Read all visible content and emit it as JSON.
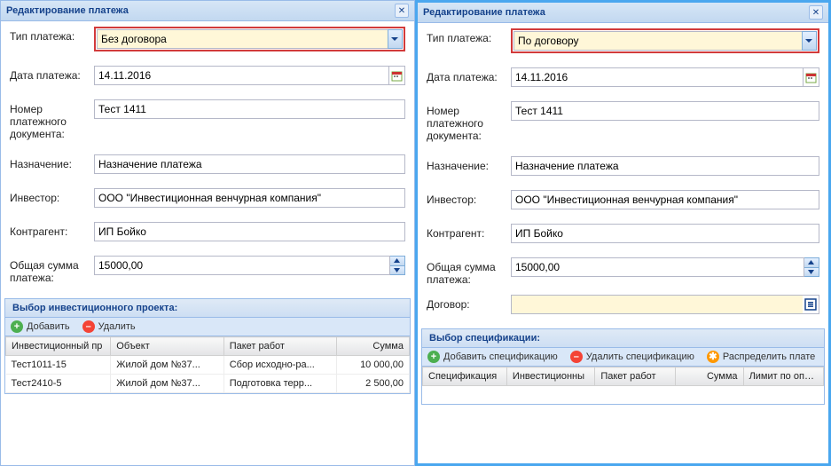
{
  "left": {
    "title": "Редактирование платежа",
    "fields": {
      "type_label": "Тип платежа:",
      "type_value": "Без договора",
      "date_label": "Дата платежа:",
      "date_value": "14.11.2016",
      "docnum_label": "Номер платежного документа:",
      "docnum_value": "Тест 1411",
      "purpose_label": "Назначение:",
      "purpose_value": "Назначение платежа",
      "investor_label": "Инвестор:",
      "investor_value": "ООО \"Инвестиционная венчурная компания\"",
      "contractor_label": "Контрагент:",
      "contractor_value": "ИП Бойко",
      "total_label": "Общая сумма платежа:",
      "total_value": "15000,00"
    },
    "panel_title": "Выбор инвестиционного проекта:",
    "toolbar": {
      "add": "Добавить",
      "del": "Удалить"
    },
    "grid": {
      "cols": [
        "Инвестиционный пр",
        "Объект",
        "Пакет работ",
        "Сумма"
      ],
      "rows": [
        {
          "proj": "Тест1011-15",
          "obj": "Жилой дом №37...",
          "pkg": "Сбор исходно-ра...",
          "sum": "10 000,00"
        },
        {
          "proj": "Тест2410-5",
          "obj": "Жилой дом №37...",
          "pkg": "Подготовка терр...",
          "sum": "2 500,00"
        }
      ]
    }
  },
  "right": {
    "title": "Редактирование платежа",
    "fields": {
      "type_label": "Тип платежа:",
      "type_value": "По договору",
      "date_label": "Дата платежа:",
      "date_value": "14.11.2016",
      "docnum_label": "Номер платежного документа:",
      "docnum_value": "Тест 1411",
      "purpose_label": "Назначение:",
      "purpose_value": "Назначение платежа",
      "investor_label": "Инвестор:",
      "investor_value": "ООО \"Инвестиционная венчурная компания\"",
      "contractor_label": "Контрагент:",
      "contractor_value": "ИП Бойко",
      "total_label": "Общая сумма платежа:",
      "total_value": "15000,00",
      "contract_label": "Договор:",
      "contract_value": ""
    },
    "panel_title": "Выбор спецификации:",
    "toolbar": {
      "add": "Добавить спецификацию",
      "del": "Удалить спецификацию",
      "dist": "Распределить плате"
    },
    "grid": {
      "cols": [
        "Спецификация",
        "Инвестиционны",
        "Пакет работ",
        "Сумма",
        "Лимит по оплат"
      ]
    }
  }
}
